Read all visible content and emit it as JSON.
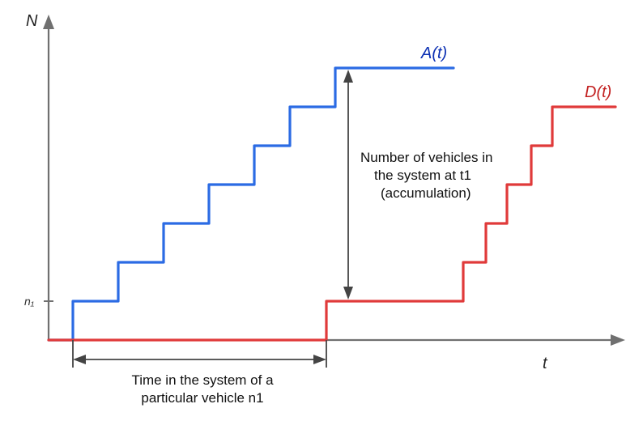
{
  "chart_data": {
    "type": "line",
    "title": "",
    "xlabel": "t",
    "ylabel": "N",
    "x_range": [
      0,
      12
    ],
    "y_range": [
      0,
      8
    ],
    "series": [
      {
        "name": "A(t)",
        "description": "Cumulative arrival curve (step function)",
        "steps_x": [
          0,
          1,
          2,
          3,
          4,
          5,
          6,
          7,
          8
        ],
        "steps_y": [
          0,
          1,
          2,
          3,
          4,
          5,
          6,
          7,
          7
        ]
      },
      {
        "name": "D(t)",
        "description": "Cumulative departure curve (step function)",
        "steps_x": [
          0,
          6,
          9,
          9.5,
          10,
          10.5,
          11,
          11.5,
          12
        ],
        "steps_y": [
          0,
          0,
          1,
          2,
          3,
          4,
          5,
          6,
          6
        ]
      }
    ],
    "annotations": [
      {
        "text": "Number of vehicles in the system at t1 (accumulation)",
        "orientation": "vertical",
        "between": [
          "A(t)",
          "D(t)"
        ],
        "at_x": 7
      },
      {
        "text": "Time in the system of a particular vehicle n1",
        "orientation": "horizontal",
        "at_y": 1
      }
    ],
    "y_tick_labels": [
      "n1"
    ]
  },
  "labels": {
    "y_axis": "N",
    "x_axis": "t",
    "curve_a": "A(t)",
    "curve_d": "D(t)",
    "n1": "n₁",
    "vertical_anno_l1": "Number of vehicles in",
    "vertical_anno_l2": "the system at t1",
    "vertical_anno_l3": "(accumulation)",
    "horiz_anno_l1": "Time in the system of a",
    "horiz_anno_l2": "particular vehicle n1"
  }
}
